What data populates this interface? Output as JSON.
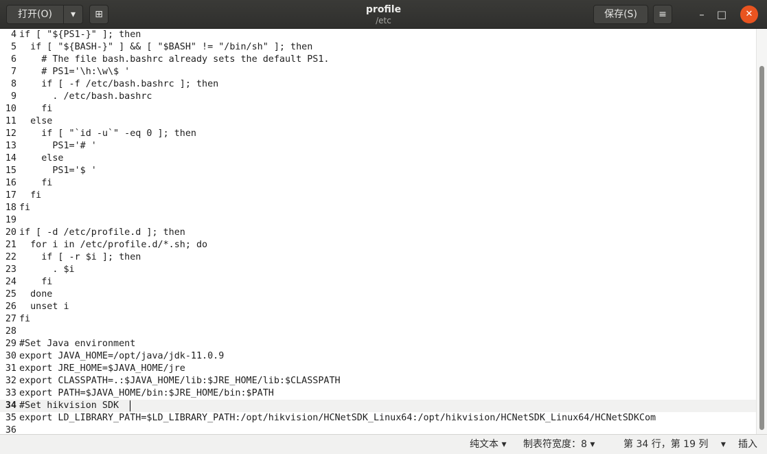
{
  "header": {
    "open_label": "打开(O)",
    "open_menu_icon": "▾",
    "new_tab_icon": "⊞",
    "title": "profile",
    "subtitle": "/etc",
    "save_label": "保存(S)",
    "menu_icon": "≡",
    "minimize_icon": "–",
    "maximize_icon": "□",
    "close_icon": "✕",
    "accent_color": "#e95420"
  },
  "editor": {
    "current_line": 34,
    "lines": [
      {
        "n": "4",
        "text": "if [ \"${PS1-}\" ]; then"
      },
      {
        "n": "5",
        "text": "  if [ \"${BASH-}\" ] && [ \"$BASH\" != \"/bin/sh\" ]; then"
      },
      {
        "n": "6",
        "text": "    # The file bash.bashrc already sets the default PS1."
      },
      {
        "n": "7",
        "text": "    # PS1='\\h:\\w\\$ '"
      },
      {
        "n": "8",
        "text": "    if [ -f /etc/bash.bashrc ]; then"
      },
      {
        "n": "9",
        "text": "      . /etc/bash.bashrc"
      },
      {
        "n": "10",
        "text": "    fi"
      },
      {
        "n": "11",
        "text": "  else"
      },
      {
        "n": "12",
        "text": "    if [ \"`id -u`\" -eq 0 ]; then"
      },
      {
        "n": "13",
        "text": "      PS1='# '"
      },
      {
        "n": "14",
        "text": "    else"
      },
      {
        "n": "15",
        "text": "      PS1='$ '"
      },
      {
        "n": "16",
        "text": "    fi"
      },
      {
        "n": "17",
        "text": "  fi"
      },
      {
        "n": "18",
        "text": "fi"
      },
      {
        "n": "19",
        "text": ""
      },
      {
        "n": "20",
        "text": "if [ -d /etc/profile.d ]; then"
      },
      {
        "n": "21",
        "text": "  for i in /etc/profile.d/*.sh; do"
      },
      {
        "n": "22",
        "text": "    if [ -r $i ]; then"
      },
      {
        "n": "23",
        "text": "      . $i"
      },
      {
        "n": "24",
        "text": "    fi"
      },
      {
        "n": "25",
        "text": "  done"
      },
      {
        "n": "26",
        "text": "  unset i"
      },
      {
        "n": "27",
        "text": "fi"
      },
      {
        "n": "28",
        "text": ""
      },
      {
        "n": "29",
        "text": "#Set Java environment"
      },
      {
        "n": "30",
        "text": "export JAVA_HOME=/opt/java/jdk-11.0.9"
      },
      {
        "n": "31",
        "text": "export JRE_HOME=$JAVA_HOME/jre"
      },
      {
        "n": "32",
        "text": "export CLASSPATH=.:$JAVA_HOME/lib:$JRE_HOME/lib:$CLASSPATH"
      },
      {
        "n": "33",
        "text": "export PATH=$JAVA_HOME/bin:$JRE_HOME/bin:$PATH"
      },
      {
        "n": "34",
        "text": "#Set hikvision SDK"
      },
      {
        "n": "35",
        "text": "export LD_LIBRARY_PATH=$LD_LIBRARY_PATH:/opt/hikvision/HCNetSDK_Linux64:/opt/hikvision/HCNetSDK_Linux64/HCNetSDKCom"
      },
      {
        "n": "36",
        "text": ""
      }
    ]
  },
  "statusbar": {
    "language": "纯文本",
    "tab_width": "制表符宽度：8",
    "position": "第 34 行，第 19 列",
    "mode": "插入",
    "dropdown_icon": "▾"
  }
}
